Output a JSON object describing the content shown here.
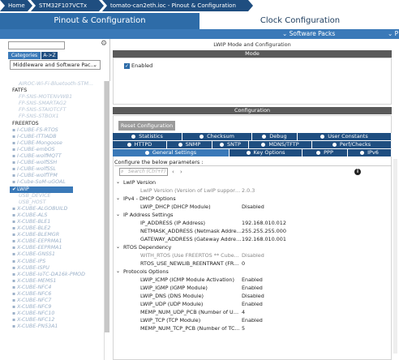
{
  "breadcrumb": [
    "Home",
    "STM32F107VCTx",
    "tomato-can2eth.ioc - Pinout & Configuration"
  ],
  "main_tabs": {
    "pinout": "Pinout & Configuration",
    "clock": "Clock Configuration"
  },
  "subbar": {
    "software_packs": "Software Packs",
    "projects": "P"
  },
  "left": {
    "categories_label": "Categories",
    "az_label": "A->Z",
    "dropdown": "Middleware and Software Pac...",
    "tree": [
      {
        "label": "AIROC-Wi-Fi-Bluetooth-STM...",
        "kind": "dim"
      },
      {
        "label": "FATFS",
        "kind": "head"
      },
      {
        "label": "FP-SNS-MOTENVWB1",
        "kind": "dim"
      },
      {
        "label": "FP-SNS-SMARTAG2",
        "kind": "dim"
      },
      {
        "label": "FP-SNS-STAIOTCFT",
        "kind": "dim"
      },
      {
        "label": "FP-SNS-STBOX1",
        "kind": "dim"
      },
      {
        "label": "FREERTOS",
        "kind": "head"
      },
      {
        "label": "I-CUBE-FS-RTOS",
        "kind": "b"
      },
      {
        "label": "I-CUBE-ITTIADB",
        "kind": "b"
      },
      {
        "label": "I-CUBE-Mongoose",
        "kind": "b"
      },
      {
        "label": "I-CUBE-embOS",
        "kind": "b"
      },
      {
        "label": "I-CUBE-wolfMQTT",
        "kind": "b"
      },
      {
        "label": "I-CUBE-wolfSSH",
        "kind": "b"
      },
      {
        "label": "I-CUBE-wolfSSL",
        "kind": "b"
      },
      {
        "label": "I-CUBE-wolfTPM",
        "kind": "b"
      },
      {
        "label": "I-Cube-SoM-uGOAL",
        "kind": "b"
      },
      {
        "label": "LWIP",
        "kind": "sel"
      },
      {
        "label": "USB_DEVICE",
        "kind": "dim"
      },
      {
        "label": "USB_HOST",
        "kind": "dim"
      },
      {
        "label": "X-CUBE-ALGOBUILD",
        "kind": "b"
      },
      {
        "label": "X-CUBE-ALS",
        "kind": "b"
      },
      {
        "label": "X-CUBE-BLE1",
        "kind": "b"
      },
      {
        "label": "X-CUBE-BLE2",
        "kind": "b"
      },
      {
        "label": "X-CUBE-BLEMGR",
        "kind": "b"
      },
      {
        "label": "X-CUBE-EEPRMA1",
        "kind": "b"
      },
      {
        "label": "X-CUBE-EEPRMA1",
        "kind": "b"
      },
      {
        "label": "X-CUBE-GNSS1",
        "kind": "b"
      },
      {
        "label": "X-CUBE-IPS",
        "kind": "b"
      },
      {
        "label": "X-CUBE-ISPU",
        "kind": "b"
      },
      {
        "label": "X-CUBE-IoTC-DA16k-PMOD",
        "kind": "b"
      },
      {
        "label": "X-CUBE-MEMS1",
        "kind": "b"
      },
      {
        "label": "X-CUBE-NFC4",
        "kind": "b"
      },
      {
        "label": "X-CUBE-NFC6",
        "kind": "b"
      },
      {
        "label": "X-CUBE-NFC7",
        "kind": "b"
      },
      {
        "label": "X-CUBE-NFC9",
        "kind": "b"
      },
      {
        "label": "X-CUBE-NFC10",
        "kind": "b"
      },
      {
        "label": "X-CUBE-NFC12",
        "kind": "b"
      },
      {
        "label": "X-CUBE-PN53A1",
        "kind": "b"
      }
    ]
  },
  "right": {
    "title": "LWIP Mode and Configuration",
    "mode_header": "Mode",
    "enabled_label": "Enabled",
    "config_header": "Configuration",
    "reset_button": "Reset Configuration",
    "tabs_row1": [
      "Statistics",
      "Checksum",
      "Debug",
      "User Constants"
    ],
    "tabs_row2": [
      "HTTPD",
      "SNMP",
      "SNTP",
      "MDNS/TFTP",
      "Perf/Checks"
    ],
    "tabs_row3": [
      "General Settings",
      "Key Options",
      "PPP",
      "IPv6"
    ],
    "configure_below": "Configure the below parameters :",
    "search_placeholder": "Search (Ctrl+F)",
    "params": [
      {
        "type": "group",
        "label": "LwIP Version"
      },
      {
        "type": "row",
        "name": "LwIP Version (Version of LwIP supported...",
        "value": "2.0.3",
        "gray": true
      },
      {
        "type": "group",
        "label": "IPv4 - DHCP Options"
      },
      {
        "type": "row",
        "name": "LWIP_DHCP (DHCP Module)",
        "value": "Disabled",
        "gray": false
      },
      {
        "type": "group",
        "label": "IP Address Settings"
      },
      {
        "type": "row",
        "name": "IP_ADDRESS (IP Address)",
        "value": "192.168.010.012",
        "gray": false
      },
      {
        "type": "row",
        "name": "NETMASK_ADDRESS (Netmask Address)",
        "value": "255.255.255.000",
        "gray": false
      },
      {
        "type": "row",
        "name": "GATEWAY_ADDRESS (Gateway Address)",
        "value": "192.168.010.001",
        "gray": false
      },
      {
        "type": "group",
        "label": "RTOS Dependency"
      },
      {
        "type": "row",
        "name": "WITH_RTOS (Use FREERTOS ** Cube...",
        "value": "Disabled",
        "gray": true
      },
      {
        "type": "row",
        "name": "RTOS_USE_NEWLIB_REENTRANT (FR...",
        "value": "0",
        "gray": false
      },
      {
        "type": "group",
        "label": "Protocols Options"
      },
      {
        "type": "row",
        "name": "LWIP_ICMP (ICMP Module Activation)",
        "value": "Enabled",
        "gray": false
      },
      {
        "type": "row",
        "name": "LWIP_IGMP (IGMP Module)",
        "value": "Enabled",
        "gray": false
      },
      {
        "type": "row",
        "name": "LWIP_DNS (DNS Module)",
        "value": "Disabled",
        "gray": false
      },
      {
        "type": "row",
        "name": "LWIP_UDP (UDP Module)",
        "value": "Enabled",
        "gray": false
      },
      {
        "type": "row",
        "name": "MEMP_NUM_UDP_PCB (Number of UD...",
        "value": "4",
        "gray": false
      },
      {
        "type": "row",
        "name": "LWIP_TCP (TCP Module)",
        "value": "Enabled",
        "gray": false
      },
      {
        "type": "row",
        "name": "MEMP_NUM_TCP_PCB (Number of TC...",
        "value": "5",
        "gray": false
      }
    ]
  },
  "colors": {
    "accent": "#2e6ca8",
    "dark": "#1f4e80",
    "crumb": "#1f4e80",
    "header_strip": "#5a5a5a"
  }
}
